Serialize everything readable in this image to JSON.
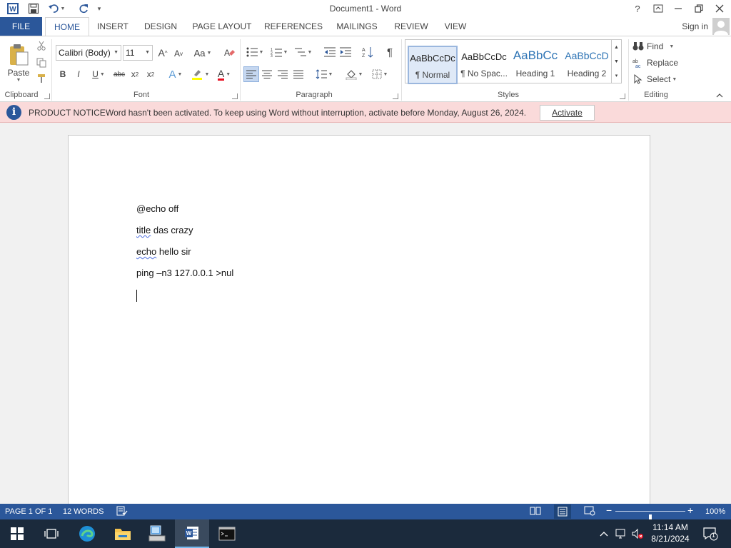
{
  "window": {
    "title": "Document1 - Word",
    "help": "?",
    "signin": "Sign in"
  },
  "tabs": [
    "FILE",
    "HOME",
    "INSERT",
    "DESIGN",
    "PAGE LAYOUT",
    "REFERENCES",
    "MAILINGS",
    "REVIEW",
    "VIEW"
  ],
  "ribbon": {
    "clipboard": {
      "paste_label": "Paste",
      "group_label": "Clipboard"
    },
    "font": {
      "font_name": "Calibri (Body)",
      "font_size": "11",
      "grow": "A",
      "shrink": "A",
      "change_case": "Aa",
      "bold": "B",
      "italic": "I",
      "underline": "U",
      "strike": "abc",
      "subscript": "x",
      "superscript": "x",
      "text_effects": "A",
      "font_color": "A",
      "group_label": "Font",
      "font_color_swatch": "#e81123",
      "highlight_swatch": "#ffff00"
    },
    "paragraph": {
      "pilcrow": "¶",
      "group_label": "Paragraph"
    },
    "styles": {
      "items": [
        {
          "sample": "AaBbCcDc",
          "name": "¶ Normal"
        },
        {
          "sample": "AaBbCcDc",
          "name": "¶ No Spac..."
        },
        {
          "sample": "AaBbCc",
          "name": "Heading 1"
        },
        {
          "sample": "AaBbCcD",
          "name": "Heading 2"
        }
      ],
      "group_label": "Styles",
      "heading_color": "#2e74b5"
    },
    "editing": {
      "find": "Find",
      "replace": "Replace",
      "select": "Select",
      "group_label": "Editing"
    }
  },
  "notice": {
    "label": "PRODUCT NOTICE",
    "text": "Word hasn't been activated. To keep using Word without interruption, activate before Monday, August 26, 2024.",
    "button": "Activate"
  },
  "document": {
    "lines": [
      {
        "parts": [
          {
            "text": "@echo off",
            "spell": false
          }
        ]
      },
      {
        "parts": [
          {
            "text": "title",
            "spell": true
          },
          {
            "text": " das crazy",
            "spell": false
          }
        ]
      },
      {
        "parts": [
          {
            "text": "echo",
            "spell": true
          },
          {
            "text": " hello sir",
            "spell": false
          }
        ]
      },
      {
        "parts": [
          {
            "text": "ping –n3 127.0.0.1 >nul",
            "spell": false
          }
        ]
      }
    ]
  },
  "status": {
    "page": "PAGE 1 OF 1",
    "words": "12 WORDS",
    "zoom": "100%",
    "zoom_level": 1.0,
    "zoom_minus": "−",
    "zoom_plus": "+"
  },
  "taskbar": {
    "time": "11:14 AM",
    "date": "8/21/2024",
    "notifications": "1",
    "icons": [
      "windows-start-icon",
      "task-view-icon",
      "edge-browser-icon",
      "file-explorer-icon",
      "network-computer-icon",
      "word-app-icon",
      "command-prompt-icon"
    ]
  },
  "colors": {
    "accent": "#2b579a",
    "notice_bg": "#fadada",
    "taskbar": "#1b2a3c"
  }
}
